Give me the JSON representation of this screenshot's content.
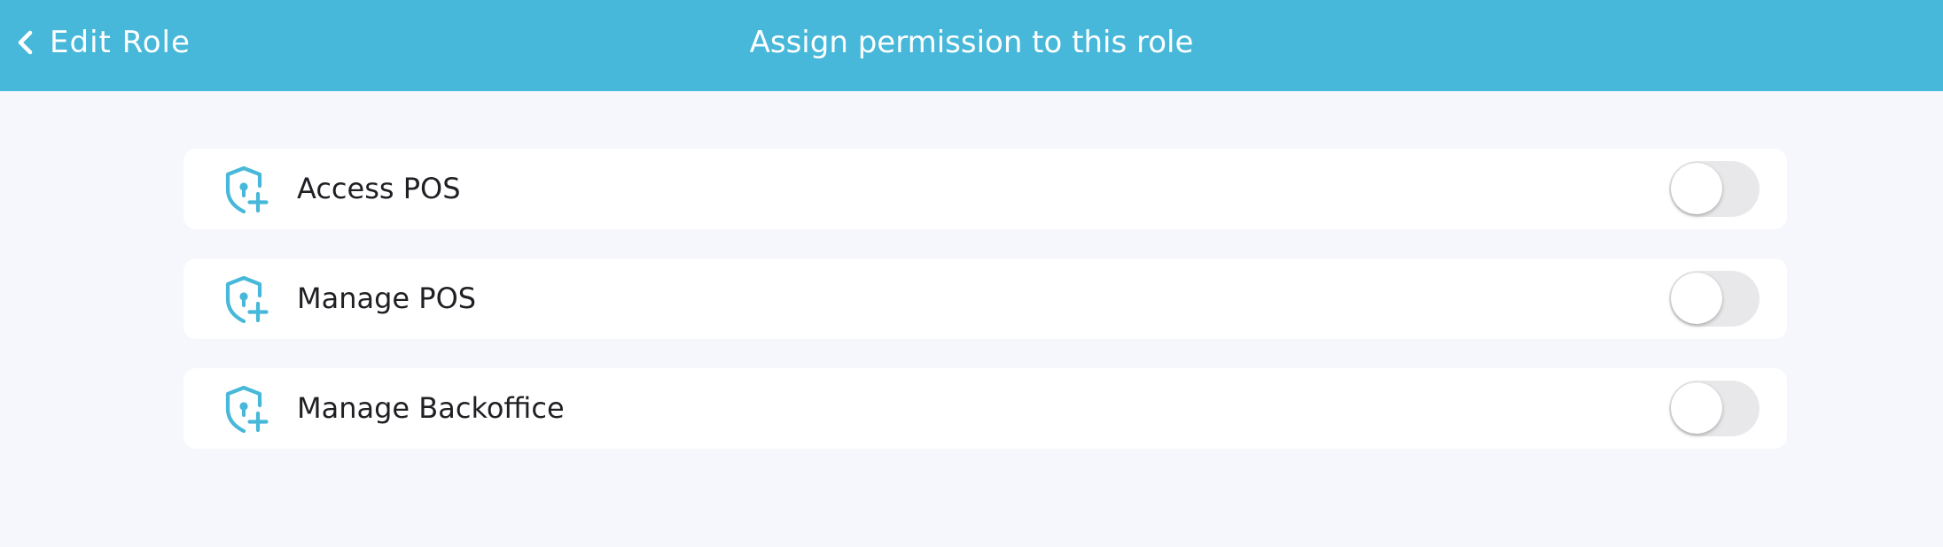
{
  "header": {
    "back_label": "Edit Role",
    "title": "Assign permission to this role"
  },
  "permissions": [
    {
      "label": "Access POS",
      "icon": "shield-keyhole-plus-icon",
      "enabled": false
    },
    {
      "label": "Manage POS",
      "icon": "shield-keyhole-plus-icon",
      "enabled": false
    },
    {
      "label": "Manage Backoffice",
      "icon": "shield-keyhole-plus-icon",
      "enabled": false
    }
  ],
  "colors": {
    "header_bg": "#47b8d9",
    "page_bg": "#f5f7fc",
    "icon": "#47b8d9",
    "toggle_off": "#e8e8ea"
  }
}
